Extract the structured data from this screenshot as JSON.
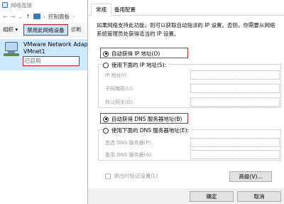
{
  "background": {
    "title": "网络连接",
    "breadcrumb": "控制面板",
    "cmdbar": {
      "organize": "组织 ▾",
      "disable": "禁用此网络设备",
      "diagnose": "诊断"
    },
    "adapter": {
      "name": "VMware Network Adapter",
      "name2": "VMnet1",
      "status": "已启用"
    }
  },
  "dialog": {
    "tabs": [
      "常规",
      "备用配置"
    ],
    "description": "如果网络支持此功能，则可以获取自动指派的 IP 设置。否则，你需要从网络系统管理员处获得适当的 IP 设置。",
    "ip_auto_label": "自动获得 IP 地址(O)",
    "ip_manual_label": "使用下面的 IP 地址(S):",
    "ip_fields": [
      "IP 地址(I):",
      "子网掩码(U):",
      "默认网关(D):"
    ],
    "dns_auto_label": "自动获得 DNS 服务器地址(B)",
    "dns_manual_label": "使用下面的 DNS 服务器地址(E):",
    "dns_fields": [
      "首选 DNS 服务器(P):",
      "备用 DNS 服务器(A):"
    ],
    "validate_label": "退出时验证设置(L)",
    "advanced_label": "高级(V)...",
    "ok_label": "确定",
    "cancel_label": "取消"
  },
  "colors": {
    "highlight": "#e21b1b",
    "selection": "#cce8ff"
  }
}
